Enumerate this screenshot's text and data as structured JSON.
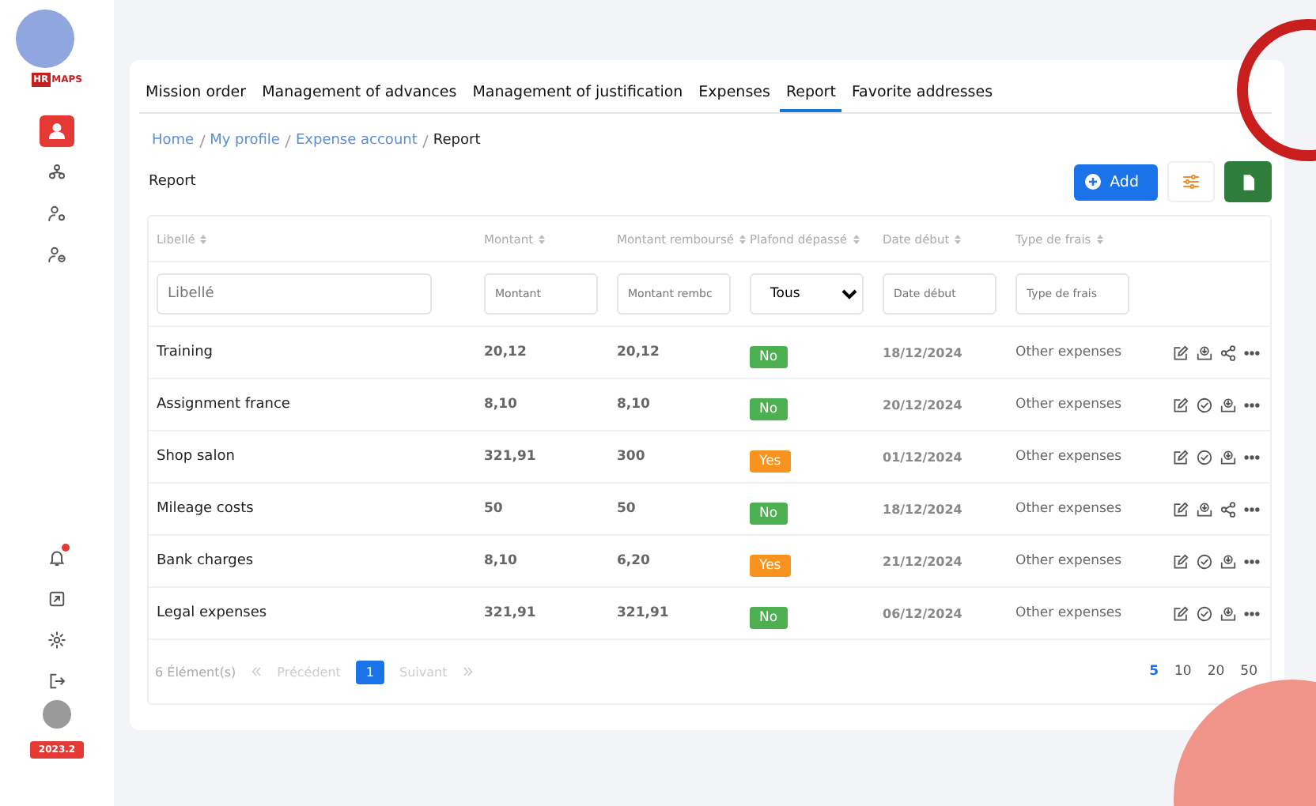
{
  "sidebar": {
    "logo": {
      "mark": "HR",
      "word": "MAPS"
    },
    "nav": [
      {
        "kind": "user",
        "selected": true
      },
      {
        "kind": "org",
        "selected": false
      },
      {
        "kind": "usergear",
        "selected": false
      },
      {
        "kind": "userminus",
        "selected": false
      }
    ],
    "bottom": [
      {
        "kind": "bell",
        "alert": true
      },
      {
        "kind": "export",
        "alert": false
      },
      {
        "kind": "gear",
        "alert": false
      },
      {
        "kind": "logout",
        "alert": false
      }
    ],
    "version": "2023.2"
  },
  "tabs": [
    {
      "label": "Mission order",
      "selected": false
    },
    {
      "label": "Management of advances",
      "selected": false
    },
    {
      "label": "Management of justification",
      "selected": false
    },
    {
      "label": "Expenses",
      "selected": false
    },
    {
      "label": "Report",
      "selected": true
    },
    {
      "label": "Favorite addresses",
      "selected": false
    }
  ],
  "breadcrumb": [
    {
      "label": "Home",
      "link": true
    },
    {
      "label": "My profile",
      "link": true
    },
    {
      "label": "Expense account",
      "link": true
    },
    {
      "label": "Report",
      "link": false
    }
  ],
  "title": "Report",
  "add_button": "Add",
  "table": {
    "columns": [
      "Libellé",
      "Montant",
      "Montant remboursé",
      "Plafond dépassé",
      "Date début",
      "Type de frais"
    ],
    "filters": [
      {
        "kind": "text",
        "placeholder": "Libellé"
      },
      {
        "kind": "text",
        "placeholder": "Montant"
      },
      {
        "kind": "text",
        "placeholder": "Montant rembc"
      },
      {
        "kind": "select",
        "value": "Tous"
      },
      {
        "kind": "text",
        "placeholder": "Date début"
      },
      {
        "kind": "text",
        "placeholder": "Type de frais"
      }
    ],
    "rows": [
      {
        "label": "Training",
        "amount": "20,12",
        "refunded": "20,12",
        "exceeded": {
          "label": "No",
          "on": false
        },
        "date": "18/12/2024",
        "type": "Other expenses",
        "actions": [
          {
            "kind": "edit"
          },
          {
            "kind": "download"
          },
          {
            "kind": "share"
          },
          {
            "kind": "more"
          }
        ]
      },
      {
        "label": "Assignment france",
        "amount": "8,10",
        "refunded": "8,10",
        "exceeded": {
          "label": "No",
          "on": false
        },
        "date": "20/12/2024",
        "type": "Other expenses",
        "actions": [
          {
            "kind": "edit"
          },
          {
            "kind": "check"
          },
          {
            "kind": "download"
          },
          {
            "kind": "more"
          }
        ]
      },
      {
        "label": "Shop salon",
        "amount": "321,91",
        "refunded": "300",
        "exceeded": {
          "label": "Yes",
          "on": true
        },
        "date": "01/12/2024",
        "type": "Other expenses",
        "actions": [
          {
            "kind": "edit"
          },
          {
            "kind": "check"
          },
          {
            "kind": "download"
          },
          {
            "kind": "more"
          }
        ]
      },
      {
        "label": "Mileage costs",
        "amount": "50",
        "refunded": "50",
        "exceeded": {
          "label": "No",
          "on": false
        },
        "date": "18/12/2024",
        "type": "Other expenses",
        "actions": [
          {
            "kind": "edit"
          },
          {
            "kind": "download"
          },
          {
            "kind": "share"
          },
          {
            "kind": "more"
          }
        ]
      },
      {
        "label": "Bank charges",
        "amount": "8,10",
        "refunded": "6,20",
        "exceeded": {
          "label": "Yes",
          "on": true
        },
        "date": "21/12/2024",
        "type": "Other expenses",
        "actions": [
          {
            "kind": "edit"
          },
          {
            "kind": "check"
          },
          {
            "kind": "download"
          },
          {
            "kind": "more"
          }
        ]
      },
      {
        "label": "Legal expenses",
        "amount": "321,91",
        "refunded": "321,91",
        "exceeded": {
          "label": "No",
          "on": false
        },
        "date": "06/12/2024",
        "type": "Other expenses",
        "actions": [
          {
            "kind": "edit"
          },
          {
            "kind": "check"
          },
          {
            "kind": "download"
          },
          {
            "kind": "more"
          }
        ]
      }
    ]
  },
  "pagination": {
    "count": "6 Élément(s)",
    "prev": "Précédent",
    "next": "Suivant",
    "pages": [
      {
        "label": "1",
        "selected": true
      }
    ],
    "sizes": [
      {
        "label": "5",
        "selected": true
      },
      {
        "label": "10",
        "selected": false
      },
      {
        "label": "20",
        "selected": false
      },
      {
        "label": "50",
        "selected": false
      }
    ]
  }
}
